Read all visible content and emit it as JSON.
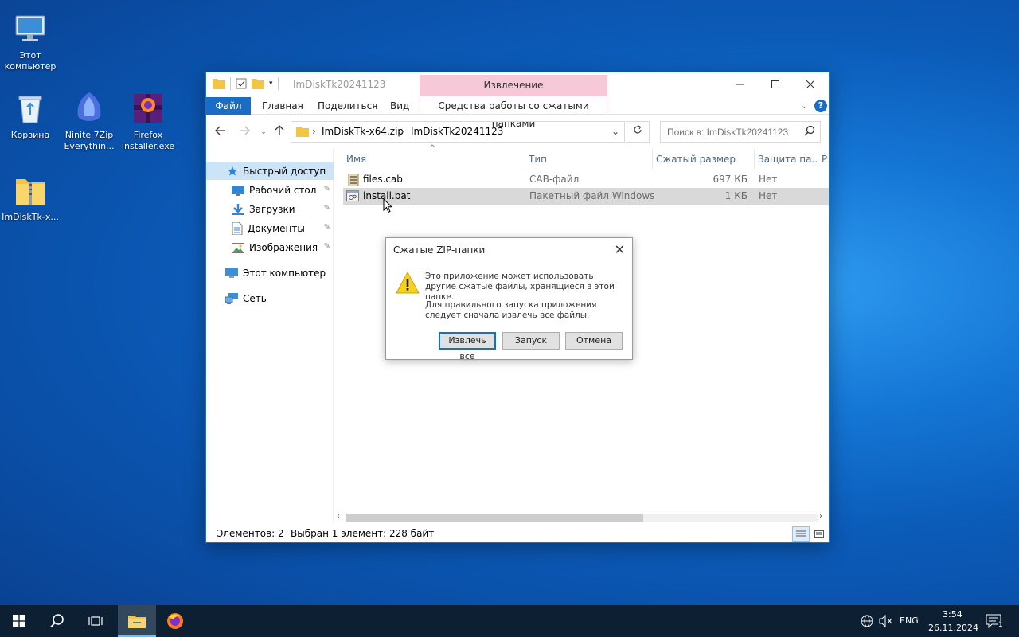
{
  "desktop": {
    "icons": [
      {
        "label": "Этот компьютер"
      },
      {
        "label": "Корзина"
      },
      {
        "label": "Ninite 7Zip Everythin..."
      },
      {
        "label": "Firefox Installer.exe"
      },
      {
        "label": "ImDiskTk-x..."
      }
    ]
  },
  "window": {
    "title": "ImDiskTk20241123",
    "context_tab_group": "Извлечение",
    "tabs": {
      "file": "Файл",
      "home": "Главная",
      "share": "Поделиться",
      "view": "Вид",
      "compressed_tools": "Средства работы со сжатыми папками"
    },
    "help": "?",
    "address": {
      "crumb1": "ImDiskTk-x64.zip",
      "crumb2": "ImDiskTk20241123",
      "separator": "›"
    },
    "search_placeholder": "Поиск в: ImDiskTk20241123",
    "nav": {
      "quick_access": "Быстрый доступ",
      "desktop": "Рабочий стол",
      "downloads": "Загрузки",
      "documents": "Документы",
      "pictures": "Изображения",
      "this_pc": "Этот компьютер",
      "network": "Сеть"
    },
    "columns": {
      "name": "Имя",
      "type": "Тип",
      "compressed_size": "Сжатый размер",
      "protection": "Защита па...",
      "extra": "Р"
    },
    "files": [
      {
        "name": "files.cab",
        "type": "CAB-файл",
        "size": "697 КБ",
        "protected": "Нет"
      },
      {
        "name": "install.bat",
        "type": "Пакетный файл Windows",
        "size": "1 КБ",
        "protected": "Нет"
      }
    ],
    "status": {
      "items": "Элементов: 2",
      "selected": "Выбран 1 элемент: 228 байт"
    }
  },
  "dialog": {
    "title": "Сжатые ZIP-папки",
    "message1": "Это приложение может использовать другие сжатые файлы, хранящиеся в этой папке.",
    "message2": "Для правильного запуска приложения следует сначала извлечь все файлы.",
    "buttons": {
      "extract_all": "Извлечь все",
      "run": "Запуск",
      "cancel": "Отмена"
    }
  },
  "taskbar": {
    "language": "ENG",
    "time": "3:54",
    "date": "26.11.2024",
    "notification_count": "1"
  },
  "colors": {
    "accent": "#1a6cc7",
    "context_tab": "#f7c8d8",
    "selection": "#cce4f7",
    "taskbar": "#0c1f33"
  }
}
